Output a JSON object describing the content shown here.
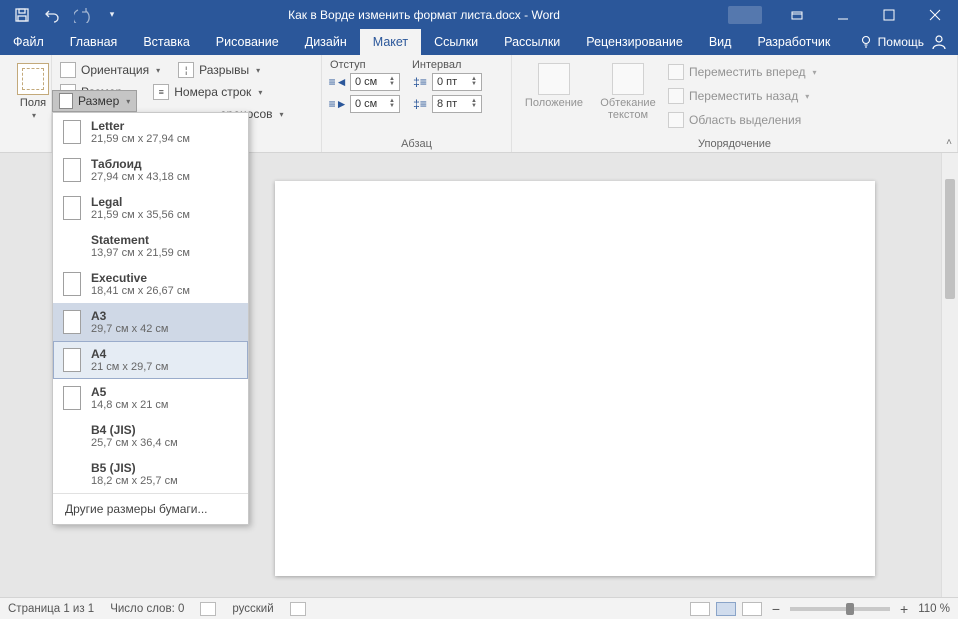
{
  "title": "Как в Ворде изменить формат листа.docx  -  Word",
  "tabs": {
    "file": "Файл",
    "home": "Главная",
    "insert": "Вставка",
    "draw": "Рисование",
    "design": "Дизайн",
    "layout": "Макет",
    "references": "Ссылки",
    "mailings": "Рассылки",
    "review": "Рецензирование",
    "view": "Вид",
    "developer": "Разработчик",
    "help": "Помощь"
  },
  "ribbon": {
    "margins": "Поля",
    "orientation": "Ориентация",
    "size": "Размер",
    "breaks": "Разрывы",
    "line_numbers": "Номера строк",
    "hyphenation_tail": "ереносов",
    "indent": "Отступ",
    "spacing": "Интервал",
    "left_val": "0 см",
    "right_val": "0 см",
    "before_val": "0 пт",
    "after_val": "8 пт",
    "group_para": "Абзац",
    "position": "Положение",
    "wrap": "Обтекание текстом",
    "bring_forward": "Переместить вперед",
    "send_backward": "Переместить назад",
    "selection_pane": "Область выделения",
    "group_arrange": "Упорядочение"
  },
  "sizes": [
    {
      "name": "Letter",
      "dim": "21,59 см x 27,94 см",
      "thumb": true
    },
    {
      "name": "Таблоид",
      "dim": "27,94 см x 43,18 см",
      "thumb": true
    },
    {
      "name": "Legal",
      "dim": "21,59 см x 35,56 см",
      "thumb": true
    },
    {
      "name": "Statement",
      "dim": "13,97 см x 21,59 см",
      "thumb": false
    },
    {
      "name": "Executive",
      "dim": "18,41 см x 26,67 см",
      "thumb": true
    },
    {
      "name": "A3",
      "dim": "29,7 см x 42 см",
      "thumb": true
    },
    {
      "name": "A4",
      "dim": "21 см x 29,7 см",
      "thumb": true
    },
    {
      "name": "A5",
      "dim": "14,8 см x 21 см",
      "thumb": true
    },
    {
      "name": "B4 (JIS)",
      "dim": "25,7 см x 36,4 см",
      "thumb": false
    },
    {
      "name": "B5 (JIS)",
      "dim": "18,2 см x 25,7 см",
      "thumb": false
    }
  ],
  "size_footer": "Другие размеры бумаги...",
  "status": {
    "page": "Страница 1 из 1",
    "words": "Число слов: 0",
    "lang": "русский",
    "zoom_minus": "−",
    "zoom_plus": "+",
    "zoom": "110 %"
  }
}
